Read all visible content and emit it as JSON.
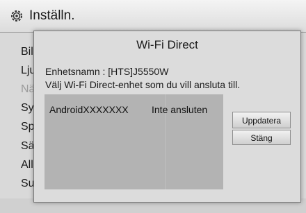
{
  "header": {
    "title": "Inställn.",
    "icon": "gear-icon"
  },
  "menu": {
    "items": [
      {
        "label": "Bil",
        "dim": false
      },
      {
        "label": "Lju",
        "dim": false
      },
      {
        "label": "Nä",
        "dim": true
      },
      {
        "label": "Sy",
        "dim": false
      },
      {
        "label": "Sp",
        "dim": false
      },
      {
        "label": "Sä",
        "dim": false
      },
      {
        "label": "All",
        "dim": false
      },
      {
        "label": "Su",
        "dim": false
      }
    ]
  },
  "dialog": {
    "title": "Wi-Fi Direct",
    "device_name": "Enhetsnamn : [HTS]J5550W",
    "instruction": "Välj Wi-Fi Direct-enhet som du vill ansluta till.",
    "devices": [
      {
        "name": "AndroidXXXXXXX",
        "status": "Inte ansluten"
      }
    ],
    "buttons": {
      "refresh": "Uppdatera",
      "close": "Stäng"
    }
  }
}
